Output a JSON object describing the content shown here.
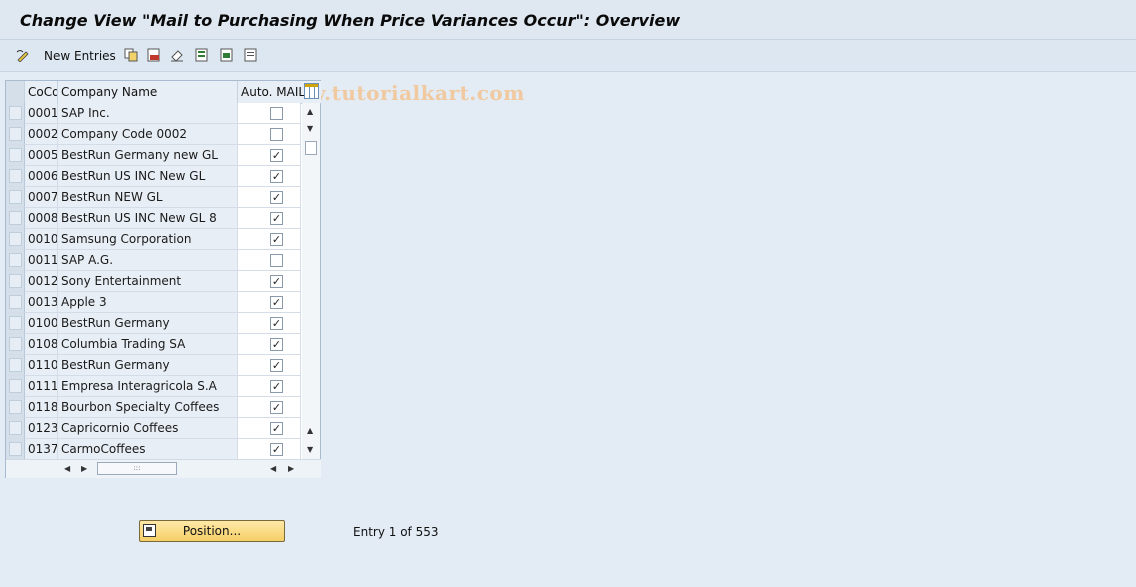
{
  "window": {
    "title": "Change View \"Mail to Purchasing When Price Variances Occur\": Overview"
  },
  "toolbar": {
    "new_entries_label": "New Entries",
    "watermark": "www.tutorialkart.com"
  },
  "table": {
    "columns": [
      "CoCd",
      "Company Name",
      "Auto. MAIL"
    ],
    "rows": [
      {
        "code": "0001",
        "name": "SAP Inc.",
        "checked": false
      },
      {
        "code": "0002",
        "name": "Company Code 0002",
        "checked": false
      },
      {
        "code": "0005",
        "name": "BestRun Germany new GL",
        "checked": true
      },
      {
        "code": "0006",
        "name": "BestRun US INC New GL",
        "checked": true
      },
      {
        "code": "0007",
        "name": "BestRun NEW GL",
        "checked": true
      },
      {
        "code": "0008",
        "name": "BestRun US INC New GL 8",
        "checked": true
      },
      {
        "code": "0010",
        "name": "Samsung Corporation",
        "checked": true
      },
      {
        "code": "0011",
        "name": "SAP A.G.",
        "checked": false
      },
      {
        "code": "0012",
        "name": "Sony Entertainment",
        "checked": true
      },
      {
        "code": "0013",
        "name": "Apple 3",
        "checked": true
      },
      {
        "code": "0100",
        "name": "BestRun Germany",
        "checked": true
      },
      {
        "code": "0108",
        "name": "Columbia Trading SA",
        "checked": true
      },
      {
        "code": "0110",
        "name": "BestRun Germany",
        "checked": true
      },
      {
        "code": "0111",
        "name": "Empresa Interagricola S.A",
        "checked": true
      },
      {
        "code": "0118",
        "name": "Bourbon Specialty Coffees",
        "checked": true
      },
      {
        "code": "0123",
        "name": "Capricornio Coffees",
        "checked": true
      },
      {
        "code": "0137",
        "name": "CarmoCoffees",
        "checked": true
      }
    ]
  },
  "footer": {
    "position_label": "Position...",
    "entry_text": "Entry 1 of 553"
  }
}
